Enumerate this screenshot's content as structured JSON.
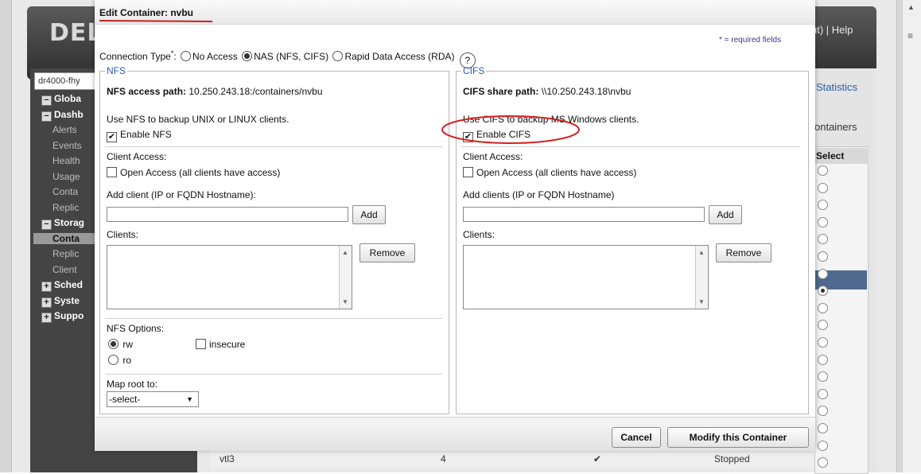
{
  "background": {
    "logo": "DELL",
    "help_link": "ut) | Help",
    "host_select": "dr4000-fhy",
    "tree": [
      {
        "label": "Globa",
        "kind": "top",
        "box": "−"
      },
      {
        "label": "Dashb",
        "kind": "top",
        "box": "−"
      },
      {
        "label": "Alerts",
        "kind": "sub"
      },
      {
        "label": "Events",
        "kind": "sub"
      },
      {
        "label": "Health",
        "kind": "sub"
      },
      {
        "label": "Usage",
        "kind": "sub"
      },
      {
        "label": "Conta",
        "kind": "sub"
      },
      {
        "label": "Replic",
        "kind": "sub"
      },
      {
        "label": "Storag",
        "kind": "top",
        "box": "−"
      },
      {
        "label": "Conta",
        "kind": "sel"
      },
      {
        "label": "Replic",
        "kind": "sub"
      },
      {
        "label": "Client",
        "kind": "sub"
      },
      {
        "label": "Sched",
        "kind": "top",
        "box": "+"
      },
      {
        "label": "Syste",
        "kind": "top",
        "box": "+"
      },
      {
        "label": "Suppo",
        "kind": "top",
        "box": "+"
      }
    ],
    "statistics_link": "Statistics",
    "containers_label": "ontainers",
    "select_header": "Select",
    "bottom_row": {
      "name": "vtl3",
      "count": "4",
      "check": "✔",
      "status": "Stopped"
    }
  },
  "dialog": {
    "title": "Edit Container: nvbu",
    "required_note": "* = required fields",
    "connection_type": {
      "label": "Connection Type",
      "required_mark": "*",
      "colon": ":",
      "options": [
        {
          "label": "No Access",
          "selected": false
        },
        {
          "label": "NAS (NFS, CIFS)",
          "selected": true
        },
        {
          "label": "Rapid Data Access (RDA)",
          "selected": false
        }
      ],
      "help_icon": "?"
    },
    "nfs": {
      "legend": "NFS",
      "path_label": "NFS access path:",
      "path_value": " 10.250.243.18:/containers/nvbu",
      "description": "Use NFS to backup UNIX or LINUX clients.",
      "enable_label": "Enable NFS",
      "enabled": true,
      "client_access_label": "Client Access:",
      "open_access_label": "Open Access (all clients have access)",
      "add_client_label": "Add client (IP or FQDN Hostname):",
      "add_client_value": "",
      "add_button": "Add",
      "clients_label": "Clients:",
      "remove_button": "Remove",
      "options_label": "NFS Options:",
      "rw_label": "rw",
      "ro_label": "ro",
      "insecure_label": "insecure",
      "map_root_label": "Map root to:",
      "map_root_value": "-select-"
    },
    "cifs": {
      "legend": "CIFS",
      "path_label": "CIFS share path:",
      "path_value": " \\\\10.250.243.18\\nvbu",
      "description": "Use CIFS to backup MS Windows clients.",
      "enable_label": "Enable CIFS",
      "enabled": true,
      "client_access_label": "Client Access:",
      "open_access_label": "Open Access (all clients have access)",
      "add_client_label": "Add clients (IP or FQDN Hostname)",
      "add_client_value": "",
      "add_button": "Add",
      "clients_label": "Clients:",
      "remove_button": "Remove"
    },
    "cancel_button": "Cancel",
    "modify_button": "Modify this Container"
  },
  "colors": {
    "annotation_red": "#d62020",
    "legend_blue": "#2a5db0",
    "selected_row": "#4f6a8e"
  }
}
